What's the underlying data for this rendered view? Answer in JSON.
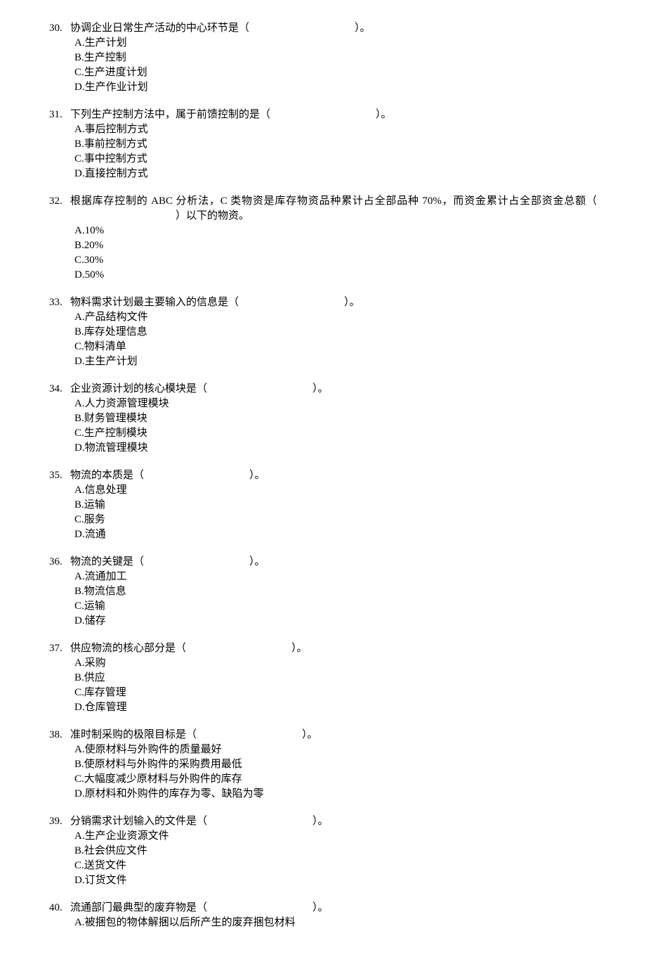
{
  "questions": [
    {
      "number": "30.",
      "stem_pre": "协调企业日常生产活动的中心环节是（",
      "stem_post": "）。",
      "options": [
        "A.生产计划",
        "B.生产控制",
        "C.生产进度计划",
        "D.生产作业计划"
      ]
    },
    {
      "number": "31.",
      "stem_pre": "下列生产控制方法中，属于前馈控制的是（",
      "stem_post": "）。",
      "options": [
        "A.事后控制方式",
        "B.事前控制方式",
        "C.事中控制方式",
        "D.直接控制方式"
      ]
    },
    {
      "number": "32.",
      "stem_pre": "根据库存控制的 ABC 分析法，C 类物资是库存物资品种累计占全部品种 70%，而资金累计占全部资金总额（",
      "stem_post": "）以下的物资。",
      "options": [
        "A.10%",
        "B.20%",
        "C.30%",
        "D.50%"
      ]
    },
    {
      "number": "33.",
      "stem_pre": "物料需求计划最主要输入的信息是（",
      "stem_post": "）。",
      "options": [
        "A.产品结构文件",
        "B.库存处理信息",
        "C.物料清单",
        "D.主生产计划"
      ]
    },
    {
      "number": "34.",
      "stem_pre": "企业资源计划的核心模块是（",
      "stem_post": "）。",
      "options": [
        "A.人力资源管理模块",
        "B.财务管理模块",
        "C.生产控制模块",
        "D.物流管理模块"
      ]
    },
    {
      "number": "35.",
      "stem_pre": "物流的本质是（",
      "stem_post": "）。",
      "options": [
        "A.信息处理",
        "B.运输",
        "C.服务",
        "D.流通"
      ]
    },
    {
      "number": "36.",
      "stem_pre": "物流的关键是（",
      "stem_post": "）。",
      "options": [
        "A.流通加工",
        "B.物流信息",
        "C.运输",
        "D.储存"
      ]
    },
    {
      "number": "37.",
      "stem_pre": "供应物流的核心部分是（",
      "stem_post": "）。",
      "options": [
        "A.采购",
        "B.供应",
        "C.库存管理",
        "D.仓库管理"
      ]
    },
    {
      "number": "38.",
      "stem_pre": "准时制采购的极限目标是（",
      "stem_post": "）。",
      "options": [
        "A.使原材料与外购件的质量最好",
        "B.使原材料与外购件的采购费用最低",
        "C.大幅度减少原材料与外购件的库存",
        "D.原材料和外购件的库存为零、缺陷为零"
      ]
    },
    {
      "number": "39.",
      "stem_pre": "分销需求计划输入的文件是（",
      "stem_post": "）。",
      "options": [
        "A.生产企业资源文件",
        "B.社会供应文件",
        "C.送货文件",
        "D.订货文件"
      ]
    },
    {
      "number": "40.",
      "stem_pre": "流通部门最典型的废弃物是（",
      "stem_post": "）。",
      "options": [
        "A.被捆包的物体解捆以后所产生的废弃捆包材料"
      ]
    }
  ]
}
